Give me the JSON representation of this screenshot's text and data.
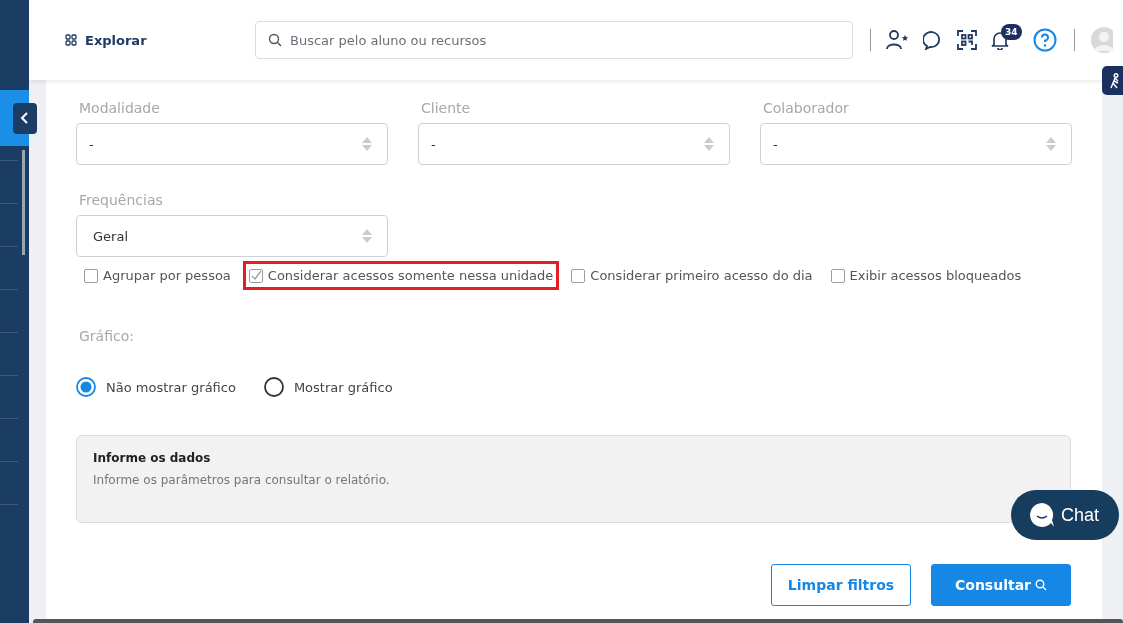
{
  "header": {
    "explore_label": "Explorar",
    "search": {
      "placeholder": "Buscar pelo aluno ou recursos"
    },
    "notification_count": "34"
  },
  "filters": [
    {
      "label": "Modalidade",
      "value": "-"
    },
    {
      "label": "Cliente",
      "value": "-"
    },
    {
      "label": "Colaborador",
      "value": "-"
    }
  ],
  "frequency": {
    "label": "Frequências",
    "value": "Geral"
  },
  "checkboxes": [
    {
      "label": "Agrupar por pessoa",
      "checked": false,
      "highlighted": false
    },
    {
      "label": "Considerar acessos somente nessa unidade",
      "checked": true,
      "highlighted": true
    },
    {
      "label": "Considerar primeiro acesso do dia",
      "checked": false,
      "highlighted": false
    },
    {
      "label": "Exibir acessos bloqueados",
      "checked": false,
      "highlighted": false
    }
  ],
  "chart_option": {
    "label": "Gráfico:",
    "options": [
      {
        "label": "Não mostrar gráfico",
        "selected": true
      },
      {
        "label": "Mostrar gráfico",
        "selected": false
      }
    ]
  },
  "info": {
    "title": "Informe os dados",
    "text": "Informe os parâmetros para consultar o relatório."
  },
  "buttons": {
    "clear": "Limpar filtros",
    "submit": "Consultar"
  },
  "chat": {
    "label": "Chat"
  }
}
